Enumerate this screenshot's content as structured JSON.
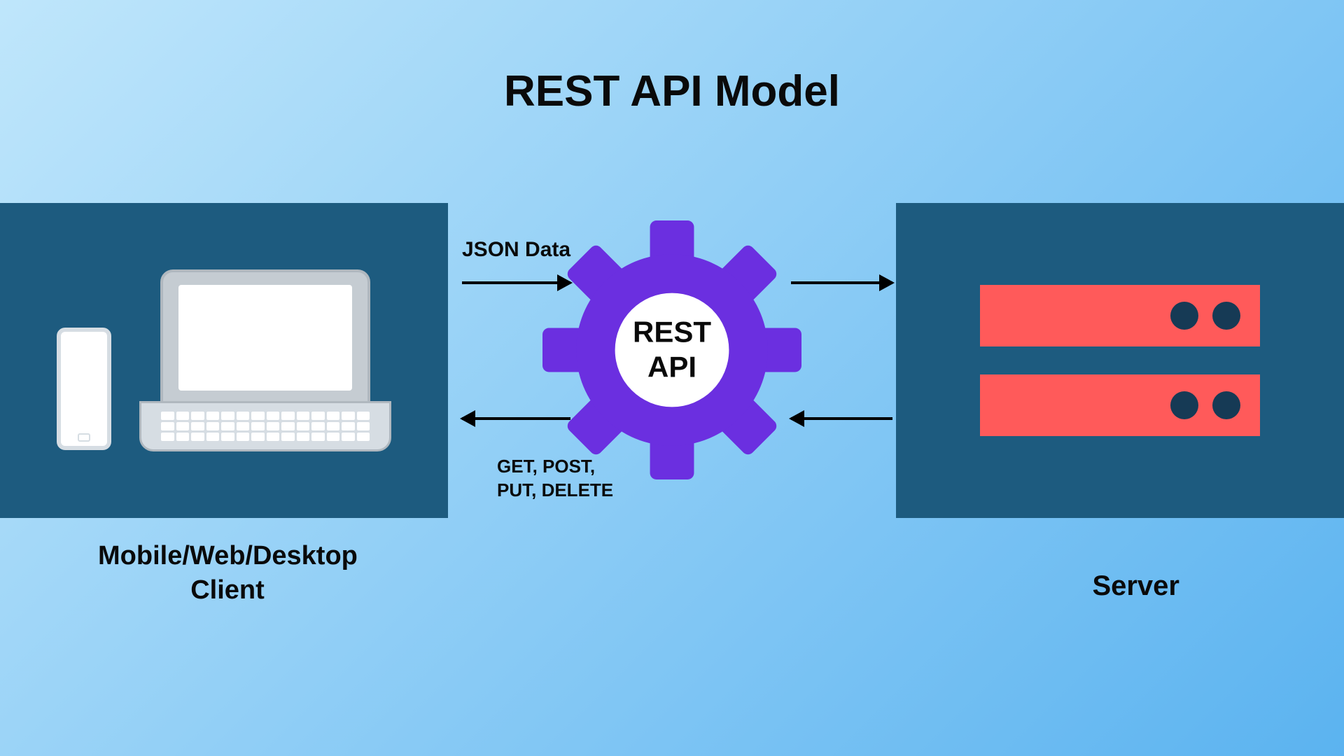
{
  "title": "REST API Model",
  "client": {
    "label": "Mobile/Web/Desktop Client"
  },
  "server": {
    "label": "Server"
  },
  "gear": {
    "line1": "REST",
    "line2": "API"
  },
  "flow": {
    "request_label": "JSON Data",
    "methods_label": "GET, POST, PUT, DELETE"
  }
}
